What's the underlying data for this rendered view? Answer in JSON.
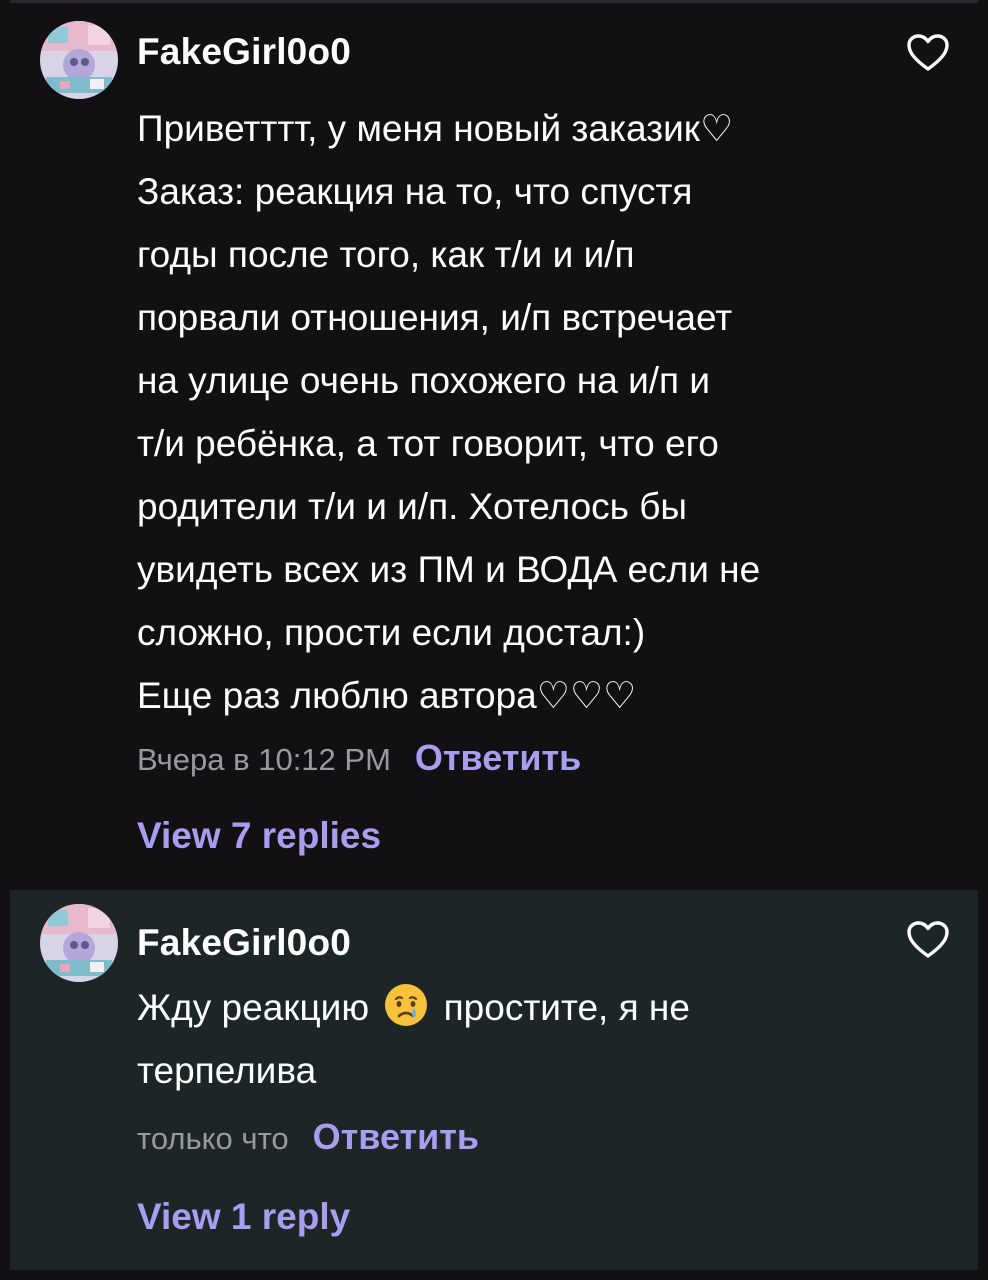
{
  "comments": [
    {
      "username": "FakeGirl0o0",
      "lines": [
        "Приветттт, у меня новый заказик♡",
        "Заказ: реакция на то, что спустя",
        "годы после того, как т/и и и/п",
        "порвали отношения, и/п встречает",
        "на улице очень похожего на и/п и",
        "т/и ребёнка, а тот говорит, что его",
        "родители т/и и и/п. Хотелось бы",
        "увидеть всех из ПМ и ВОДА если не",
        "сложно, прости если достал:)",
        "Еще раз люблю автора♡♡♡"
      ],
      "timestamp": "Вчера в 10:12 PM",
      "reply_label": "Ответить",
      "view_replies_label": "View 7 replies",
      "like_icon": "heart-outline-icon"
    },
    {
      "username": "FakeGirl0o0",
      "line1_before": "Жду реакцию",
      "emoji": "crying-face",
      "line1_after": "простите, я не",
      "line2": "терпелива",
      "timestamp": "только что",
      "reply_label": "Ответить",
      "view_replies_label": "View 1 reply",
      "like_icon": "heart-outline-icon"
    }
  ],
  "colors": {
    "background": "#121013",
    "highlight_background": "#1e2527",
    "text": "#ffffff",
    "muted": "#9a9a9e",
    "accent": "#a89ef0"
  }
}
